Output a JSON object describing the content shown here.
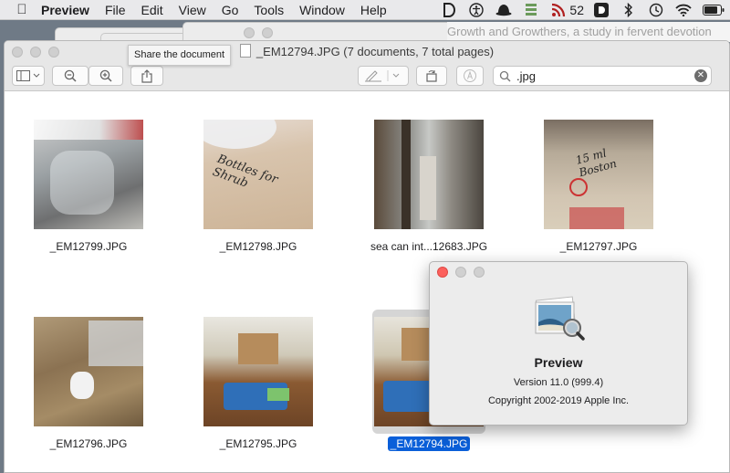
{
  "menubar": {
    "app_name": "Preview",
    "items": [
      "File",
      "Edit",
      "View",
      "Go",
      "Tools",
      "Window",
      "Help"
    ],
    "badge_count": "52"
  },
  "background_window": {
    "title": "Growth and Growthers, a study in fervent devotion"
  },
  "window": {
    "title": "_EM12794.JPG (7 documents, 7 total pages)"
  },
  "toolbar": {
    "search_value": ".jpg",
    "tooltip": "Share the document"
  },
  "thumbnails": [
    {
      "caption": "_EM12799.JPG",
      "selected": false
    },
    {
      "caption": "_EM12798.JPG",
      "selected": false
    },
    {
      "caption": "sea can int...12683.JPG",
      "selected": false
    },
    {
      "caption": "_EM12797.JPG",
      "selected": false
    },
    {
      "caption": "_EM12796.JPG",
      "selected": false
    },
    {
      "caption": "_EM12795.JPG",
      "selected": false
    },
    {
      "caption": "_EM12794.JPG",
      "selected": true
    }
  ],
  "about": {
    "app_name": "Preview",
    "version": "Version 11.0 (999.4)",
    "copyright": "Copyright 2002-2019 Apple Inc."
  },
  "colors": {
    "selection": "#0a5fd9",
    "close_light": "#fc605c"
  }
}
